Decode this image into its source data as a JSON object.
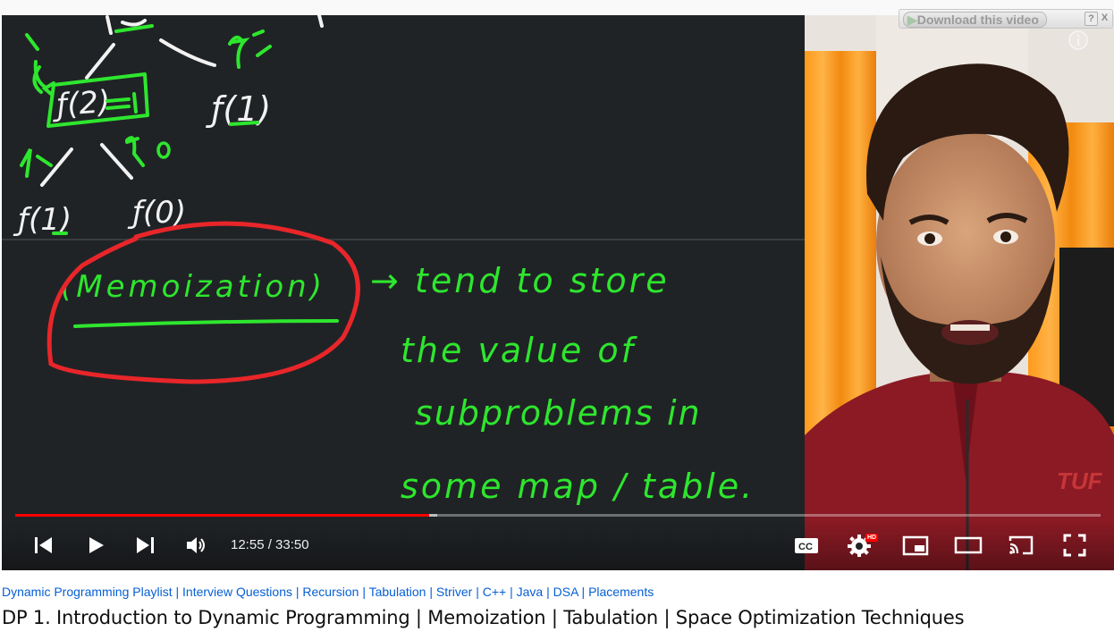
{
  "download_bar": {
    "button_label": "Download this video",
    "help_label": "?",
    "close_label": "X"
  },
  "player": {
    "current_time": "12:55",
    "duration": "33:50",
    "time_display": "12:55 / 33:50",
    "progress_fraction": 0.3815,
    "buffered_fraction": 0.3885,
    "hd_badge": "HD",
    "watermark": "TUF",
    "colors": {
      "progress_red": "#ff0000",
      "board_bg": "#202326",
      "chalk_green": "#2ee62e",
      "chalk_red": "#e8262a",
      "chalk_white": "#f2f2f2"
    }
  },
  "board_text": {
    "nodes": [
      "f(2)=1",
      "f(1)",
      "f(1)",
      "f(0)",
      "0"
    ],
    "keyword": "(Memoization)",
    "note_lines": [
      "→ tend to store",
      "the value of",
      "subproblems in",
      "some map / table."
    ]
  },
  "video": {
    "tags": [
      "Dynamic Programming Playlist",
      "Interview Questions",
      "Recursion",
      "Tabulation",
      "Striver",
      "C++",
      "Java",
      "DSA",
      "Placements"
    ],
    "title": "DP 1. Introduction to Dynamic Programming | Memoization | Tabulation | Space Optimization Techniques"
  },
  "icons": {
    "prev": "skip-previous-icon",
    "play": "play-icon",
    "next": "skip-next-icon",
    "volume": "volume-icon",
    "captions": "captions-icon",
    "settings": "settings-gear-icon",
    "miniplayer": "miniplayer-icon",
    "theater": "theater-mode-icon",
    "cast": "cast-icon",
    "fullscreen": "fullscreen-icon",
    "info": "info-icon"
  }
}
